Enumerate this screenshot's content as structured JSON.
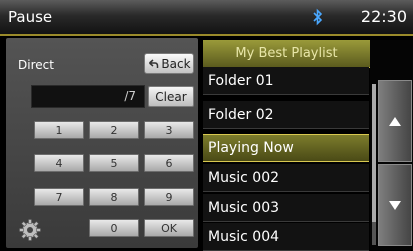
{
  "status": {
    "title": "Pause",
    "clock": "22:30",
    "bluetooth_icon": "bluetooth-icon"
  },
  "keypad": {
    "direct_label": "Direct",
    "back_label": "Back",
    "display_value": "/7",
    "clear_label": "Clear",
    "keys": [
      "1",
      "2",
      "3",
      "4",
      "5",
      "6",
      "7",
      "8",
      "9",
      "0",
      "OK"
    ]
  },
  "playlist": {
    "title": "My Best Playlist",
    "items": [
      "Folder 01",
      "Folder 02",
      "Playing Now",
      "Music 002",
      "Music 003",
      "Music 004"
    ],
    "active_index": 2
  },
  "colors": {
    "accent": "#9a9a3a",
    "highlight_border": "#d8c850"
  }
}
